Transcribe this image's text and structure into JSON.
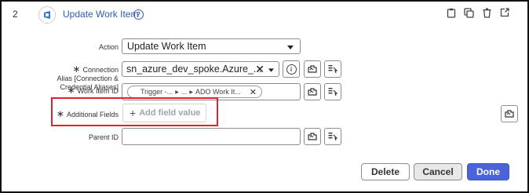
{
  "step": {
    "number": "2",
    "title": "Update Work Item",
    "icons": [
      "workflow-step-icon",
      "help-icon",
      "clipboard-icon",
      "copy-icon",
      "trash-icon",
      "open-external-icon"
    ]
  },
  "form": {
    "action": {
      "label": "Action",
      "value": "Update Work Item"
    },
    "connection_alias": {
      "label_lines": [
        "Connection",
        "Alias [Connection &",
        "Credential Aliases]"
      ],
      "value": "sn_azure_dev_spoke.Azure_..."
    },
    "work_item_id": {
      "label": "Work Item ID",
      "pill": {
        "part1": "Trigger -...",
        "part2": "...",
        "part3": "ADO Work It..."
      }
    },
    "additional_fields": {
      "label": "Additional Fields",
      "add_label": "Add field value"
    },
    "parent_id": {
      "label": "Parent ID",
      "value": ""
    }
  },
  "buttons": {
    "delete": "Delete",
    "cancel": "Cancel",
    "done": "Done"
  },
  "colors": {
    "accent": "#2f5da8",
    "done_bg": "#4a63d8",
    "highlight": "#e0232b"
  }
}
